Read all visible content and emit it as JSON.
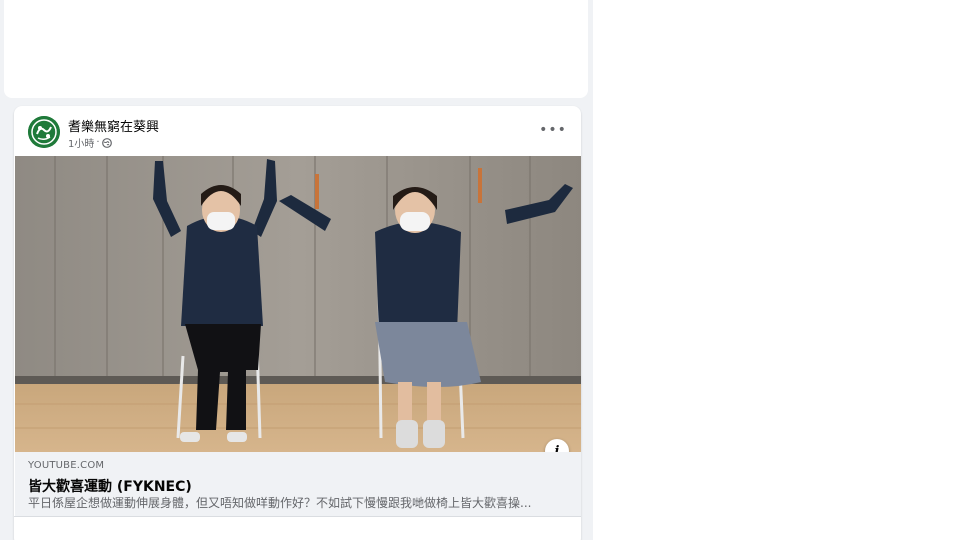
{
  "post": {
    "author": "耆樂無窮在葵興",
    "time": "1小時",
    "separator": "·",
    "privacy_icon": "globe-icon",
    "more_label": "•••",
    "info_label": "i"
  },
  "link_preview": {
    "domain": "YOUTUBE.COM",
    "title": "皆大歡喜運動 (FYKNEC)",
    "description": "平日係屋企想做運動伸展身體，但又唔知做咩動作好？不如試下慢慢跟我哋做椅上皆大歡喜操..."
  },
  "colors": {
    "feed_bg": "#f0f2f5",
    "card_bg": "#ffffff",
    "secondary_text": "#65676b",
    "avatar_green": "#1f7a3a"
  }
}
